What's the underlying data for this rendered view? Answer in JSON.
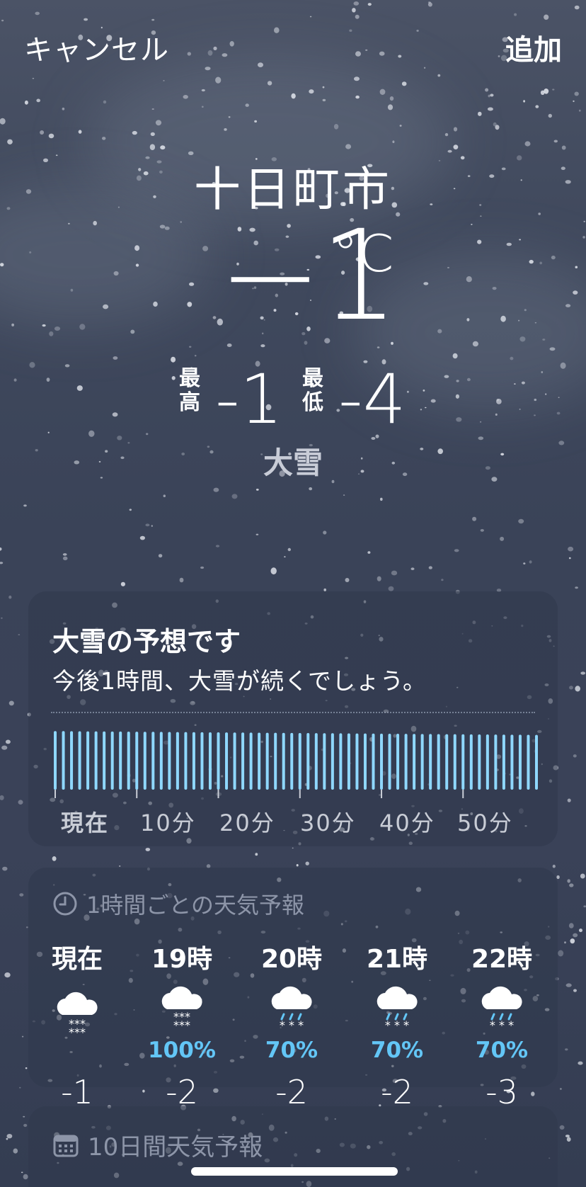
{
  "nav": {
    "cancel_label": "キャンセル",
    "add_label": "追加"
  },
  "location": {
    "city": "十日町市",
    "temperature": "−1",
    "unit": "°C",
    "high_label": "最高",
    "high_value": "-1",
    "low_label": "最低",
    "low_value": "-4",
    "condition": "大雪"
  },
  "precip_card": {
    "title": "大雪の予想です",
    "subtitle": "今後1時間、大雪が続くでしょう。",
    "intensity_start": 0.92,
    "intensity_end": 0.86,
    "ticks": [
      "現在",
      "10分",
      "20分",
      "30分",
      "40分",
      "50分"
    ]
  },
  "hourly": {
    "header": "1時間ごとの天気予報",
    "items": [
      {
        "time": "現在",
        "icon": "snow-cloud-icon",
        "pct": "",
        "temp": "-1"
      },
      {
        "time": "19時",
        "icon": "snow-cloud-icon",
        "pct": "100%",
        "temp": "-2"
      },
      {
        "time": "20時",
        "icon": "sleet-cloud-icon",
        "pct": "70%",
        "temp": "-2"
      },
      {
        "time": "21時",
        "icon": "sleet-cloud-icon",
        "pct": "70%",
        "temp": "-2"
      },
      {
        "time": "22時",
        "icon": "sleet-cloud-icon",
        "pct": "70%",
        "temp": "-3"
      }
    ]
  },
  "tenday": {
    "header": "10日間天気予報"
  },
  "colors": {
    "accent": "#63c6f6",
    "bar": "#8fd8ff",
    "background": "#3a4358"
  }
}
